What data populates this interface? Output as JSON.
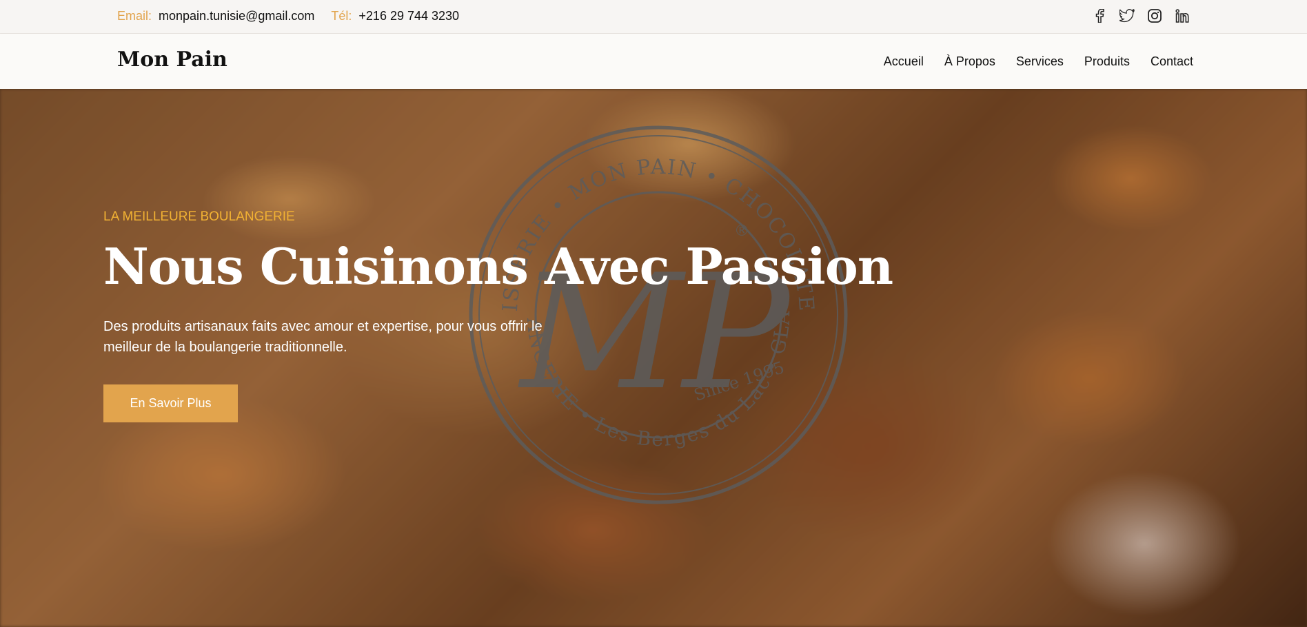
{
  "topbar": {
    "email_label": "Email:",
    "email_value": "monpain.tunisie@gmail.com",
    "phone_label": "Tél:",
    "phone_value": "+216 29 744 3230",
    "social_icons": [
      "facebook-icon",
      "twitter-icon",
      "instagram-icon",
      "linkedin-icon"
    ]
  },
  "navbar": {
    "brand": "Mon Pain",
    "items": [
      {
        "label": "Accueil"
      },
      {
        "label": "À Propos"
      },
      {
        "label": "Services"
      },
      {
        "label": "Produits"
      },
      {
        "label": "Contact"
      }
    ]
  },
  "hero": {
    "eyebrow": "LA MEILLEURE BOULANGERIE",
    "title": "Nous Cuisinons Avec Passion",
    "description": "Des produits artisanaux faits avec amour et expertise, pour vous offrir le meilleur de la boulangerie traditionnelle.",
    "cta_label": "En Savoir Plus"
  },
  "stamp": {
    "text_top": "PATISSERIE • MON PAIN • CHOCOLATERIE",
    "text_bottom": "BOULANGERIE • Les Berges du Lac • GLACIER",
    "monogram": "MP",
    "since": "Since 1995",
    "registered": "®"
  },
  "colors": {
    "accent": "#e2a44d",
    "eyebrow": "#f2b233",
    "text_dark": "#111111"
  }
}
